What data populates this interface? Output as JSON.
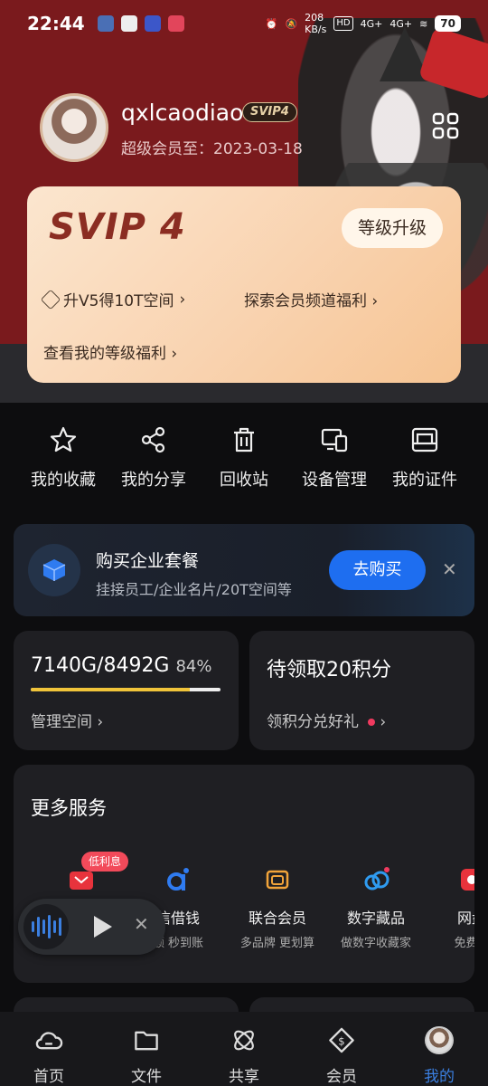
{
  "status_bar": {
    "time": "22:44",
    "net_speed": "208",
    "net_unit": "KB/s",
    "hd": "HD",
    "sig1": "4G+",
    "sig2": "4G+",
    "battery": "70"
  },
  "profile": {
    "username": "qxlcaodiao",
    "badge": "SVIP4",
    "member_until": "超级会员至：2023-03-18"
  },
  "vip_card": {
    "logo": "SVIP 4",
    "upgrade_label": "等级升级",
    "perk_upgrade": "升V5得10T空间",
    "perk_explore": "探索会员频道福利",
    "perk_levels": "查看我的等级福利"
  },
  "quick_actions": [
    {
      "label": "我的收藏",
      "icon": "star-icon"
    },
    {
      "label": "我的分享",
      "icon": "share-icon"
    },
    {
      "label": "回收站",
      "icon": "trash-icon"
    },
    {
      "label": "设备管理",
      "icon": "devices-icon"
    },
    {
      "label": "我的证件",
      "icon": "id-card-icon"
    }
  ],
  "enterprise": {
    "title": "购买企业套餐",
    "subtitle": "挂接员工/企业名片/20T空间等",
    "buy_label": "去购买"
  },
  "storage": {
    "used": "7140G/8492G",
    "percent": "84%",
    "fill": 0.84,
    "link": "管理空间"
  },
  "points": {
    "title": "待领取20积分",
    "link": "领积分兑好礼"
  },
  "services": {
    "title": "更多服务",
    "badge": "低利息",
    "items": [
      {
        "title": "",
        "sub": "",
        "icon": "wallet-icon"
      },
      {
        "title": "信借钱",
        "sub": "额 秒到账",
        "icon": "loan-icon"
      },
      {
        "title": "联合会员",
        "sub": "多品牌 更划算",
        "icon": "joint-member-icon"
      },
      {
        "title": "数字藏品",
        "sub": "做数字收藏家",
        "icon": "cloud-collection-icon"
      },
      {
        "title": "网盘",
        "sub": "免费好",
        "icon": "netdisk-icon"
      }
    ]
  },
  "nav": [
    {
      "label": "首页",
      "icon": "home-cloud-icon"
    },
    {
      "label": "文件",
      "icon": "folder-icon"
    },
    {
      "label": "共享",
      "icon": "share-atom-icon"
    },
    {
      "label": "会员",
      "icon": "vip-diamond-icon"
    },
    {
      "label": "我的",
      "icon": "avatar-icon"
    }
  ],
  "colors": {
    "hero": "#7a1a1d",
    "accent": "#1e6ef0",
    "active_nav": "#3b7fe0",
    "storage_bar": "#f0c43a",
    "badge_red": "#f24a5a"
  }
}
